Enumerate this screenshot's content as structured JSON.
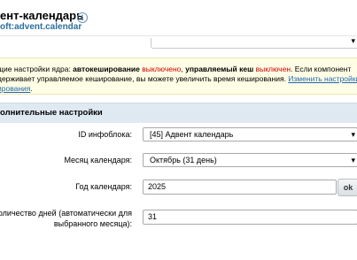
{
  "header": {
    "title": "ент-календарь",
    "module_id": "oft:advent.calendar",
    "info_icon_glyph": "i"
  },
  "notice": {
    "l1_a": "щие настройки ядра: ",
    "l1_b": "автокеширование",
    "l1_c": " ",
    "l1_d": "выключено",
    "l1_e": ", ",
    "l1_f": "управляемый кеш",
    "l1_g": " ",
    "l1_h": "выключен",
    "l1_i": ". Если компонент",
    "l2_a": "держивает управляемое кеширование, вы можете увеличить время кеширования. ",
    "l2_link": "Изменить настройки",
    "l3_link": "ирования",
    "l3_tail": "."
  },
  "section": {
    "title": "олнительные настройки"
  },
  "fields": {
    "iblock_label": "ID инфоблока:",
    "iblock_value": "[45] Адвент календарь",
    "month_label": "Месяц календаря:",
    "month_value": "Октябрь (31 день)",
    "year_label": "Год календаря:",
    "year_value": "2025",
    "days_label_1": "Количество дней (автоматически для",
    "days_label_2": "выбранного месяца):",
    "days_value": "31"
  },
  "buttons": {
    "ok_label": "ok"
  },
  "icons": {
    "dropdown": "chevron-down-icon",
    "info": "info-icon"
  },
  "colors": {
    "notice_bg": "#fefde5",
    "status_red": "#d00000",
    "link_blue": "#2067b0",
    "section_bg": "#dfe9f2",
    "module_id": "#2c6e9e"
  }
}
